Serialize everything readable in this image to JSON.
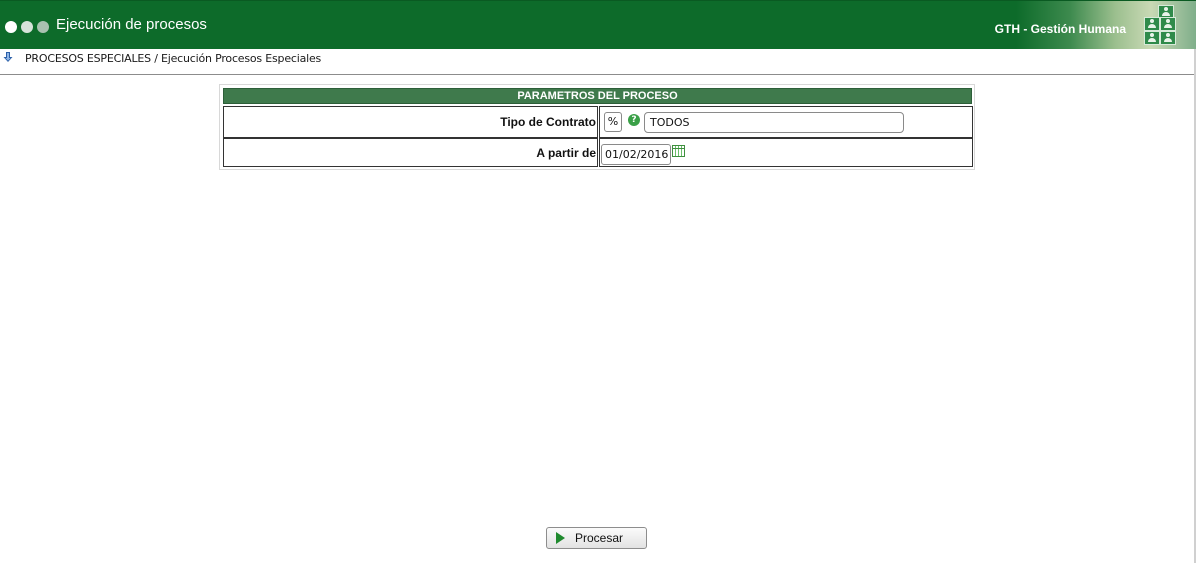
{
  "header": {
    "title": "Ejecución de procesos",
    "module": "GTH - Gestión Humana",
    "colors": {
      "bar": "#0d6b2a"
    }
  },
  "breadcrumb": {
    "icon": "arrow-down-icon",
    "path": "PROCESOS ESPECIALES / Ejecución Procesos Especiales"
  },
  "panel": {
    "title": "PARAMETROS DEL PROCESO",
    "fields": [
      {
        "label": "Tipo de Contrato",
        "code": "%",
        "description": "TODOS",
        "icon": "help-icon"
      },
      {
        "label": "A partir de",
        "value": "01/02/2016",
        "icon": "calendar-icon"
      }
    ]
  },
  "actions": {
    "process_label": "Procesar",
    "process_icon": "play-icon"
  }
}
